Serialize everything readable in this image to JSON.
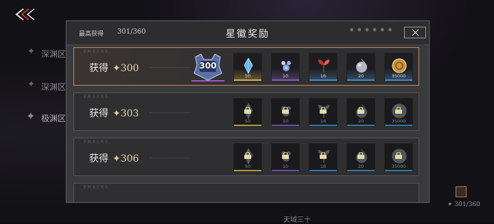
{
  "background": {
    "side_items": [
      "深渊区",
      "深渊区",
      "极渊区"
    ],
    "bottom_text": "天域三十",
    "right_counter": "✦ 301/360"
  },
  "header": {
    "high_label": "最高获得",
    "high_value": "301/360",
    "title": "星徽奖励"
  },
  "rows": [
    {
      "tag": "EMBERS",
      "label": "获得",
      "plus": "✦",
      "value": "300",
      "active": true,
      "items": [
        {
          "name": "medal-300-icon",
          "qty": "300",
          "color": "#9b59d0",
          "big": true
        },
        {
          "name": "crystal-icon",
          "qty": "50",
          "color": "#d8b64a"
        },
        {
          "name": "gem-cluster-icon",
          "qty": "10",
          "color": "#8a5cc9"
        },
        {
          "name": "sprout-icon",
          "qty": "16",
          "color": "#3d8fd1"
        },
        {
          "name": "orb-icon",
          "qty": "20",
          "color": "#3d8fd1"
        },
        {
          "name": "coin-icon",
          "qty": "35000",
          "color": "#3d8fd1"
        }
      ]
    },
    {
      "tag": "EMBERS",
      "label": "获得",
      "plus": "✦",
      "value": "303",
      "active": false,
      "items": [
        {
          "name": "crystal-icon",
          "qty": "50",
          "color": "#b89a3e"
        },
        {
          "name": "gem-cluster-icon",
          "qty": "10",
          "color": "#6f4ea8"
        },
        {
          "name": "sprout-icon",
          "qty": "16",
          "color": "#3479b0"
        },
        {
          "name": "orb-icon",
          "qty": "20",
          "color": "#3479b0"
        },
        {
          "name": "coin-icon",
          "qty": "35000",
          "color": "#3479b0"
        }
      ]
    },
    {
      "tag": "EMBERS",
      "label": "获得",
      "plus": "✦",
      "value": "306",
      "active": false,
      "items": [
        {
          "name": "crystal-icon",
          "qty": "50",
          "color": "#b89a3e"
        },
        {
          "name": "gem-cluster-icon",
          "qty": "10",
          "color": "#6f4ea8"
        },
        {
          "name": "sprout-icon",
          "qty": "16",
          "color": "#3479b0"
        },
        {
          "name": "orb-icon",
          "qty": "20",
          "color": "#3479b0"
        },
        {
          "name": "coin-icon",
          "qty": "35000",
          "color": "#3479b0"
        }
      ]
    },
    {
      "tag": "EMBERS",
      "label": "",
      "plus": "",
      "value": "",
      "active": false,
      "items": []
    }
  ]
}
